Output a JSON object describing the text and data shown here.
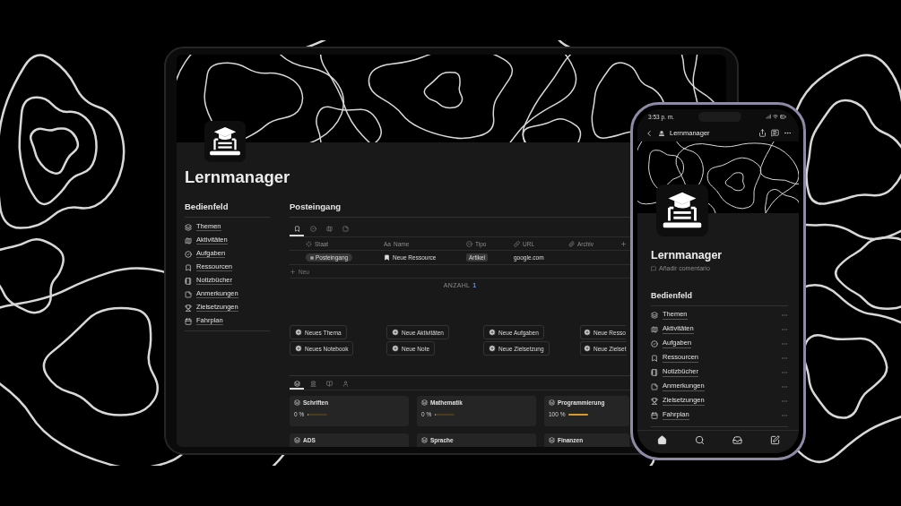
{
  "tablet": {
    "title": "Lernmanager",
    "sidebar": {
      "heading": "Bedienfeld",
      "items": [
        "Themen",
        "Aktivitäten",
        "Aufgaben",
        "Ressourcen",
        "Notizbücher",
        "Anmerkungen",
        "Zielsetzungen",
        "Fahrplan"
      ]
    },
    "inbox": {
      "heading": "Posteingang",
      "tabs": [
        {
          "selected": true
        },
        {
          "selected": false
        },
        {
          "selected": false
        },
        {
          "selected": false
        }
      ],
      "columns": [
        {
          "label": "Staat"
        },
        {
          "label": "Name",
          "prefix": "Aa"
        },
        {
          "label": "Tipo"
        },
        {
          "label": "URL"
        },
        {
          "label": "Archiv"
        }
      ],
      "rows": [
        {
          "status": "Posteingang",
          "name": "Neue Ressource",
          "type": "Artikel",
          "url": "google.com"
        }
      ],
      "new_row": "Neu",
      "count_label": "ANZAHL",
      "count": "1"
    },
    "quick_buttons": [
      [
        "Neues Thema",
        "Neue Aktivitäten",
        "Neue Aufgaben",
        "Neue Resso"
      ],
      [
        "Neues Notebook",
        "Neue Note",
        "Neue Zielsetzung",
        "Neue Zielset"
      ]
    ],
    "gallery": {
      "tabs": [
        {
          "selected": true
        },
        {
          "selected": false
        },
        {
          "selected": false
        },
        {
          "selected": false
        }
      ],
      "cards": [
        {
          "title": "Schriften",
          "reading": "0 %",
          "level": 0
        },
        {
          "title": "Mathematik",
          "reading": "0 %",
          "level": 0
        },
        {
          "title": "Programmierung",
          "reading": "100 %",
          "level": 1
        },
        {
          "title": "ADS"
        },
        {
          "title": "Sprache"
        },
        {
          "title": "Finanzen"
        }
      ]
    }
  },
  "phone": {
    "time": "3:53 p. m.",
    "nav_title": "Lernmanager",
    "title": "Lernmanager",
    "comment_placeholder": "Añadir comentario",
    "heading": "Bedienfeld",
    "items": [
      "Themen",
      "Aktivitäten",
      "Aufgaben",
      "Ressourcen",
      "Notizbücher",
      "Anmerkungen",
      "Zielsetzungen",
      "Fahrplan"
    ]
  }
}
